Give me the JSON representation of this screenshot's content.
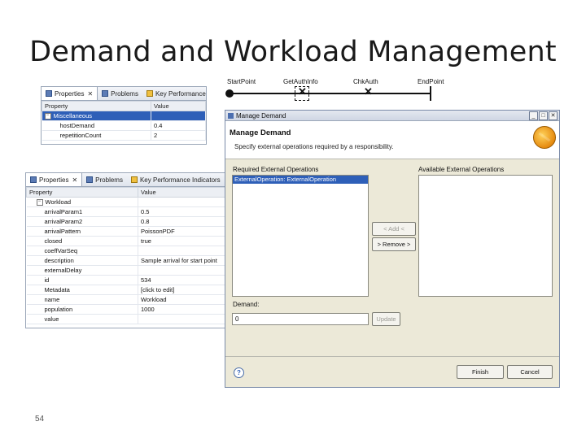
{
  "slide": {
    "title": "Demand and Workload Management",
    "page_number": "54"
  },
  "ucm_path": {
    "labels": [
      "StartPoint",
      "GetAuthInfo",
      "ChkAuth",
      "EndPoint"
    ]
  },
  "properties_top": {
    "tabs": [
      "Properties",
      "Problems",
      "Key Performance Indicators"
    ],
    "columns": [
      "Property",
      "Value"
    ],
    "rows": [
      {
        "property": "Miscellaneous",
        "value": "",
        "group": true,
        "selected": true
      },
      {
        "property": "hostDemand",
        "value": "0.4"
      },
      {
        "property": "repetitionCount",
        "value": "2"
      }
    ]
  },
  "properties_bottom": {
    "tabs": [
      "Properties",
      "Problems",
      "Key Performance Indicators"
    ],
    "columns": [
      "Property",
      "Value"
    ],
    "group": "Workload",
    "rows": [
      {
        "property": "arrivalParam1",
        "value": "0.5"
      },
      {
        "property": "arrivalParam2",
        "value": "0.8"
      },
      {
        "property": "arrivalPattern",
        "value": "PoissonPDF"
      },
      {
        "property": "closed",
        "value": "true"
      },
      {
        "property": "coeffVarSeq",
        "value": ""
      },
      {
        "property": "description",
        "value": "Sample arrival for start point"
      },
      {
        "property": "externalDelay",
        "value": ""
      },
      {
        "property": "id",
        "value": "534"
      },
      {
        "property": "Metadata",
        "value": "[click to edit]"
      },
      {
        "property": "name",
        "value": "Workload"
      },
      {
        "property": "population",
        "value": "1000"
      },
      {
        "property": "value",
        "value": ""
      }
    ]
  },
  "dialog": {
    "window_title": "Manage Demand",
    "header_title": "Manage Demand",
    "header_subtitle": "Specify external operations required by a responsibility.",
    "required_label": "Required External Operations",
    "required_items": [
      "ExternalOperation: ExternalOperation"
    ],
    "available_label": "Available External Operations",
    "add_label": "< Add <",
    "remove_label": "> Remove >",
    "demand_label": "Demand:",
    "demand_value": "0",
    "update_label": "Update",
    "finish_label": "Finish",
    "cancel_label": "Cancel",
    "help_symbol": "?"
  }
}
